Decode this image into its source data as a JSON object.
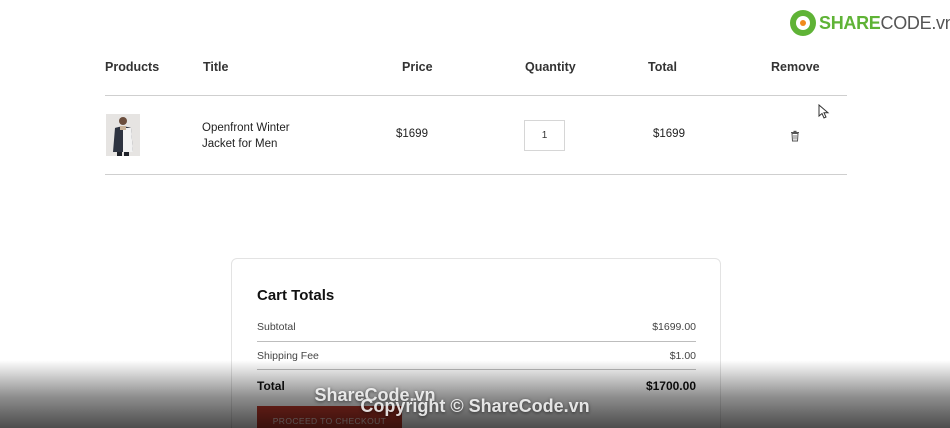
{
  "logo": {
    "brand_share": "SHARE",
    "brand_code": "CODE.vn"
  },
  "table": {
    "headers": {
      "products": "Products",
      "title": "Title",
      "price": "Price",
      "quantity": "Quantity",
      "total": "Total",
      "remove": "Remove"
    },
    "rows": [
      {
        "title": "Openfront Winter Jacket for Men",
        "price": "$1699",
        "quantity": "1",
        "total": "$1699"
      }
    ]
  },
  "cart_totals": {
    "heading": "Cart Totals",
    "subtotal_label": "Subtotal",
    "subtotal_value": "$1699.00",
    "shipping_label": "Shipping Fee",
    "shipping_value": "$1.00",
    "total_label": "Total",
    "total_value": "$1700.00",
    "checkout_label": "PROCEED TO CHECKOUT"
  },
  "watermark": {
    "line1": "ShareCode.vn",
    "line2": "Copyright © ShareCode.vn"
  },
  "colors": {
    "accent": "#c0392b",
    "logo_green": "#5fb336",
    "logo_orange": "#f08a1c"
  }
}
